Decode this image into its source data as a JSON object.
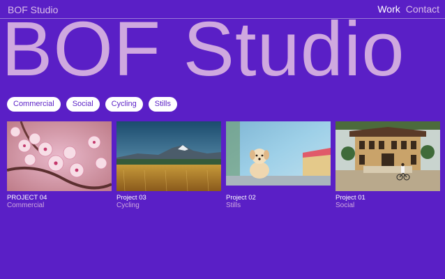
{
  "header": {
    "brand": "BOF Studio",
    "nav": [
      {
        "label": "Work",
        "active": true
      },
      {
        "label": "Contact",
        "active": false
      }
    ]
  },
  "hero": {
    "title": "BOF Studio"
  },
  "filters": [
    "Commercial",
    "Social",
    "Cycling",
    "Stills"
  ],
  "projects": [
    {
      "title": "PROJECT 04",
      "category": "Commercial",
      "image": "cherry-blossom-photo"
    },
    {
      "title": "Project 03",
      "category": "Cycling",
      "image": "mountain-wheat-field-photo"
    },
    {
      "title": "Project 02",
      "category": "Stills",
      "image": "puppy-photo"
    },
    {
      "title": "Project 01",
      "category": "Social",
      "image": "colonial-building-cyclist-photo"
    }
  ],
  "colors": {
    "background": "#5a1fc6",
    "accent": "#cfa8df",
    "pill": "#ffffff"
  }
}
